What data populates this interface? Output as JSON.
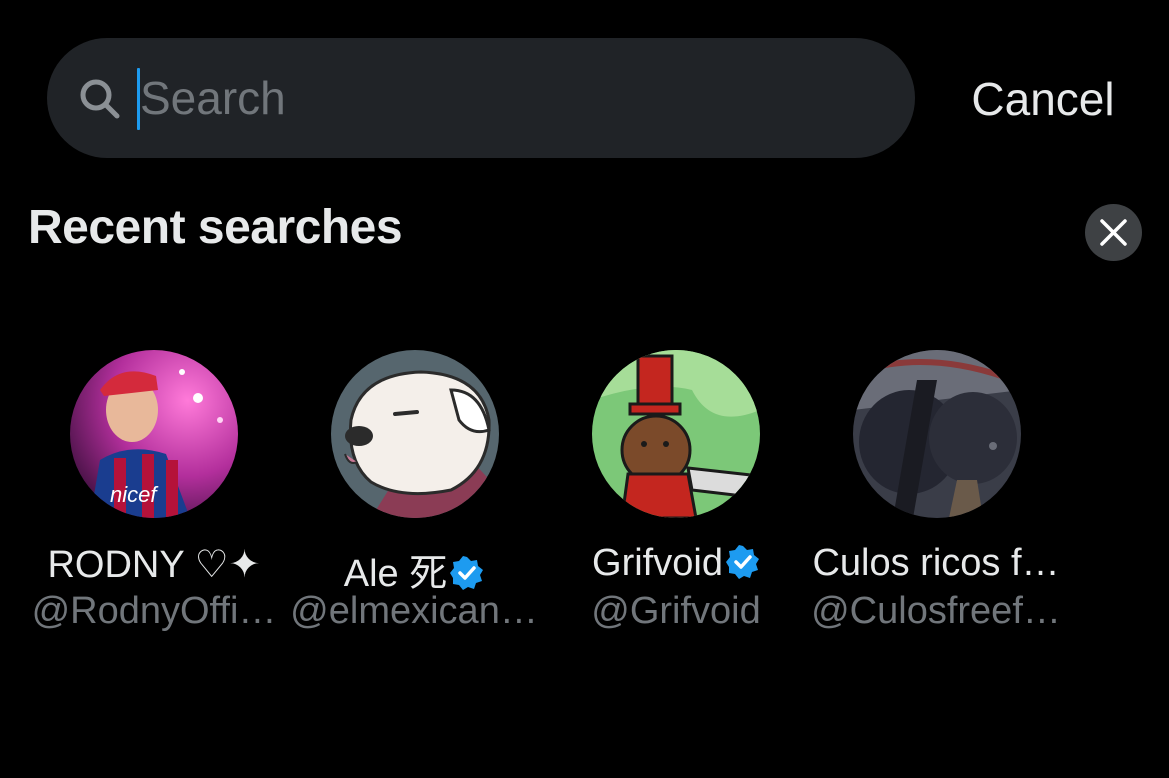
{
  "search": {
    "placeholder": "Search",
    "value": "",
    "cancel_label": "Cancel"
  },
  "recent": {
    "title": "Recent searches",
    "clear_icon": "close-icon",
    "items": [
      {
        "name": "RODNY ♡✦",
        "handle": "@RodnyOffi…",
        "verified": false,
        "avatar_colors": [
          "#c43fb6",
          "#2a0a2e",
          "#d94a8a"
        ]
      },
      {
        "name": "Ale 死",
        "handle": "@elmexican…",
        "verified": true,
        "avatar_colors": [
          "#5a6a72",
          "#f2ece8",
          "#8b3c55"
        ]
      },
      {
        "name": "Grifvoid",
        "handle": "@Grifvoid",
        "verified": true,
        "avatar_colors": [
          "#7fc97a",
          "#b12a25",
          "#7a4a2a"
        ]
      },
      {
        "name": "Culos ricos f…",
        "handle": "@Culosfreef…",
        "verified": false,
        "avatar_colors": [
          "#2a2d3a",
          "#5a5d6a",
          "#8a3a3a"
        ]
      }
    ]
  },
  "colors": {
    "background": "#000000",
    "search_bg": "#202327",
    "text_primary": "#e7e9ea",
    "text_secondary": "#71767b",
    "accent": "#1d9bf0",
    "verified": "#1d9bf0"
  }
}
